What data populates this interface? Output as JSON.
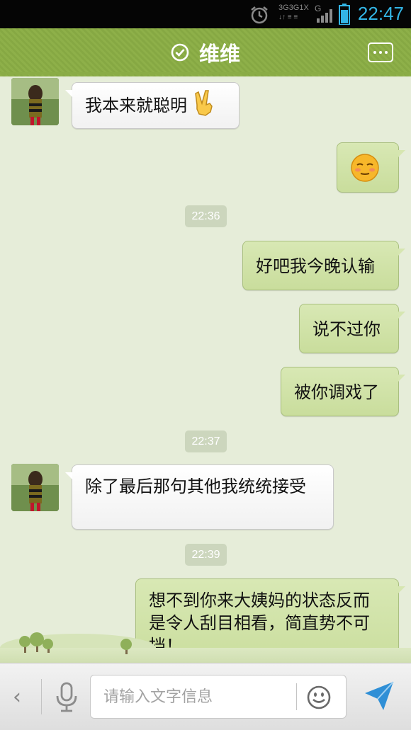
{
  "status_bar": {
    "time": "22:47",
    "network_labels": [
      "3G",
      "3G",
      "1X",
      "G"
    ],
    "icons": [
      "alarm-icon",
      "signal-icon",
      "battery-icon"
    ]
  },
  "header": {
    "title": "维维",
    "verified_icon": "check-circle-icon",
    "more_icon": "more-icon"
  },
  "conversation": {
    "messages": [
      {
        "side": "in",
        "text": "我本来就聪明",
        "emoji": "victory-hand-emoji"
      },
      {
        "side": "out",
        "text": "",
        "emoji": "blushing-face-emoji"
      },
      {
        "type": "timestamp",
        "text": "22:36"
      },
      {
        "side": "out",
        "text": "好吧我今晚认输"
      },
      {
        "side": "out",
        "text": "说不过你"
      },
      {
        "side": "out",
        "text": "被你调戏了"
      },
      {
        "type": "timestamp",
        "text": "22:37"
      },
      {
        "side": "in",
        "text": "除了最后那句其他我统统接受"
      },
      {
        "type": "timestamp",
        "text": "22:39"
      },
      {
        "side": "out",
        "text": "想不到你来大姨妈的状态反而是令人刮目相看，简直势不可挡！"
      }
    ]
  },
  "input_bar": {
    "placeholder": "请输入文字信息",
    "icons": [
      "back-chevron-icon",
      "microphone-icon",
      "smiley-icon",
      "send-icon"
    ]
  },
  "colors": {
    "header": "#8aac46",
    "chat_background": "#e6edd9",
    "outgoing_bubble": "#cfe2a6",
    "incoming_bubble": "#ffffff",
    "status_time": "#33b5e5"
  }
}
